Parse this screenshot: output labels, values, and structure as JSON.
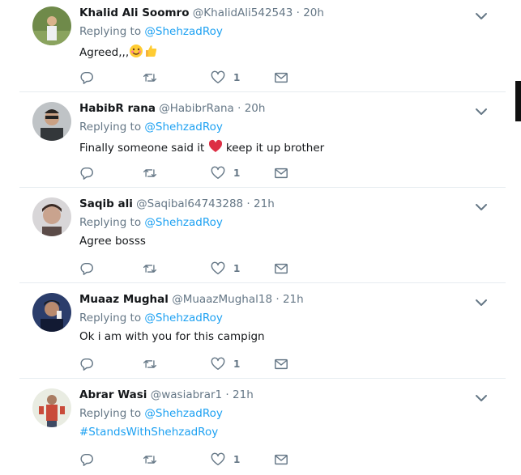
{
  "colors": {
    "accent": "#1da1f2",
    "muted": "#657786",
    "text": "#14171a",
    "divider": "#e6ecf0",
    "heart": "#e0245e"
  },
  "tweets": [
    {
      "name": "Khalid Ali Soomro",
      "handle": "@KhalidAli542543",
      "dot": "·",
      "time": "20h",
      "replying_label": "Replying to",
      "replying_user": "@ShehzadRoy",
      "text": "Agreed,,,",
      "text_emojis": [
        "smiling-face-icon",
        "thumbs-up-icon"
      ],
      "likes": "1"
    },
    {
      "name": "HabibR rana",
      "handle": "@HabibrRana",
      "dot": "·",
      "time": "20h",
      "replying_label": "Replying to",
      "replying_user": "@ShehzadRoy",
      "text": "Finally someone said it",
      "text_after": "keep it up brother",
      "likes": "1"
    },
    {
      "name": "Saqib ali",
      "handle": "@Saqibal64743288",
      "dot": "·",
      "time": "21h",
      "replying_label": "Replying to",
      "replying_user": "@ShehzadRoy",
      "text": "Agree bosss",
      "likes": "1"
    },
    {
      "name": "Muaaz Mughal",
      "handle": "@MuaazMughal18",
      "dot": "·",
      "time": "21h",
      "replying_label": "Replying to",
      "replying_user": "@ShehzadRoy",
      "text": "Ok i am with you for this campign",
      "likes": "1"
    },
    {
      "name": "Abrar Wasi",
      "handle": "@wasiabrar1",
      "dot": "·",
      "time": "21h",
      "replying_label": "Replying to",
      "replying_user": "@ShehzadRoy",
      "text": "#StandsWithShehzadRoy",
      "likes": "1"
    }
  ]
}
